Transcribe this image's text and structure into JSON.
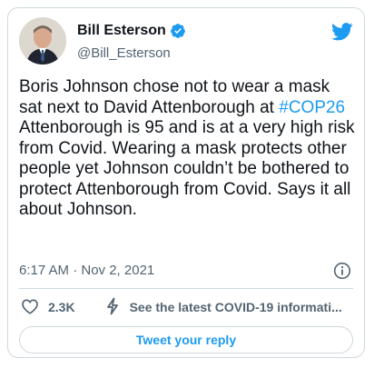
{
  "author": {
    "name": "Bill Esterson",
    "handle": "@Bill_Esterson",
    "verified": true
  },
  "tweet": {
    "text_before": "Boris Johnson chose not to wear a mask sat next to David Attenborough at ",
    "hashtag": "#COP26",
    "text_after": " Attenborough is 95 and is at a very high risk from Covid. Wearing a mask protects other people yet Johnson couldn’t be bothered to protect Attenborough from Covid. Says it all about Johnson."
  },
  "meta": {
    "timestamp": "6:17 AM · Nov 2, 2021"
  },
  "actions": {
    "like_count": "2.3K",
    "covid_label": "See the latest COVID-19 informati..."
  },
  "reply_button": "Tweet your reply",
  "colors": {
    "accent": "#1d9bf0",
    "text": "#0f1419",
    "secondary": "#536471",
    "border": "#cfd9de"
  },
  "icons": [
    "verified-badge-icon",
    "twitter-bird-icon",
    "info-icon",
    "heart-icon",
    "lightning-icon"
  ]
}
